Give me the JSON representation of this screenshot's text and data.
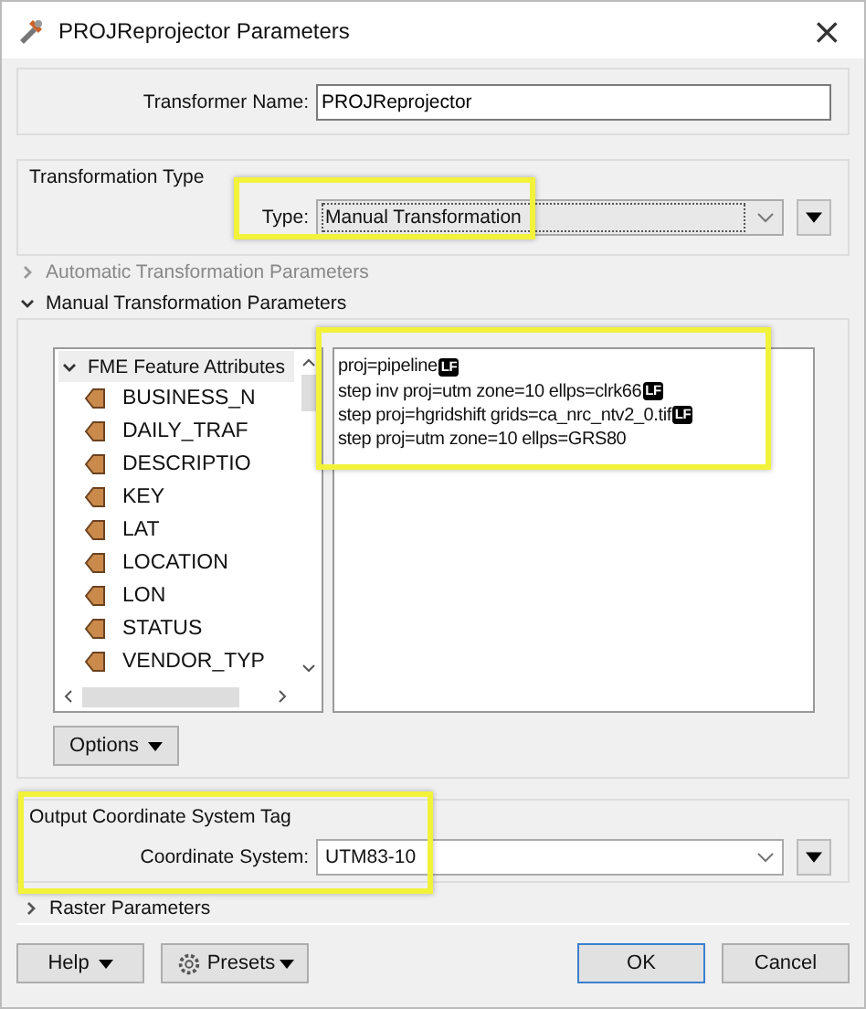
{
  "window": {
    "title": "PROJReprojector Parameters",
    "close": "×"
  },
  "transformer_name": {
    "label": "Transformer Name:",
    "value": "PROJReprojector"
  },
  "transformation_type": {
    "title": "Transformation Type",
    "label": "Type:",
    "value": "Manual Transformation"
  },
  "sections": [
    {
      "title": "Automatic Transformation Parameters",
      "expanded": false,
      "disabled": true
    },
    {
      "title": "Manual Transformation Parameters",
      "expanded": true,
      "disabled": false
    }
  ],
  "attribute_tree": {
    "label": "FME Feature Attributes",
    "expanded": true,
    "children": [
      {
        "label": "BUSINESS_N"
      },
      {
        "label": "DAILY_TRAF"
      },
      {
        "label": "DESCRIPTIO"
      },
      {
        "label": "KEY"
      },
      {
        "label": "LAT"
      },
      {
        "label": "LOCATION"
      },
      {
        "label": "LON"
      },
      {
        "label": "STATUS"
      },
      {
        "label": "VENDOR_TYP"
      }
    ]
  },
  "editor_lines": [
    {
      "text": "proj=pipeline",
      "badge": "LF"
    },
    {
      "text": "step inv proj=utm zone=10 ellps=clrk66",
      "badge": "LF"
    },
    {
      "text": "step proj=hgridshift grids=ca_nrc_ntv2_0.tif",
      "badge": "LF"
    },
    {
      "text": "step proj=utm zone=10 ellps=GRS80"
    }
  ],
  "options_button": "Options",
  "output_tag": {
    "title": "Output Coordinate System Tag",
    "label": "Coordinate System:",
    "value": "UTM83-10"
  },
  "raster_section": {
    "title": "Raster Parameters",
    "expanded": false
  },
  "buttons": {
    "help": "Help",
    "presets": "Presets",
    "ok": "OK",
    "cancel": "Cancel"
  }
}
